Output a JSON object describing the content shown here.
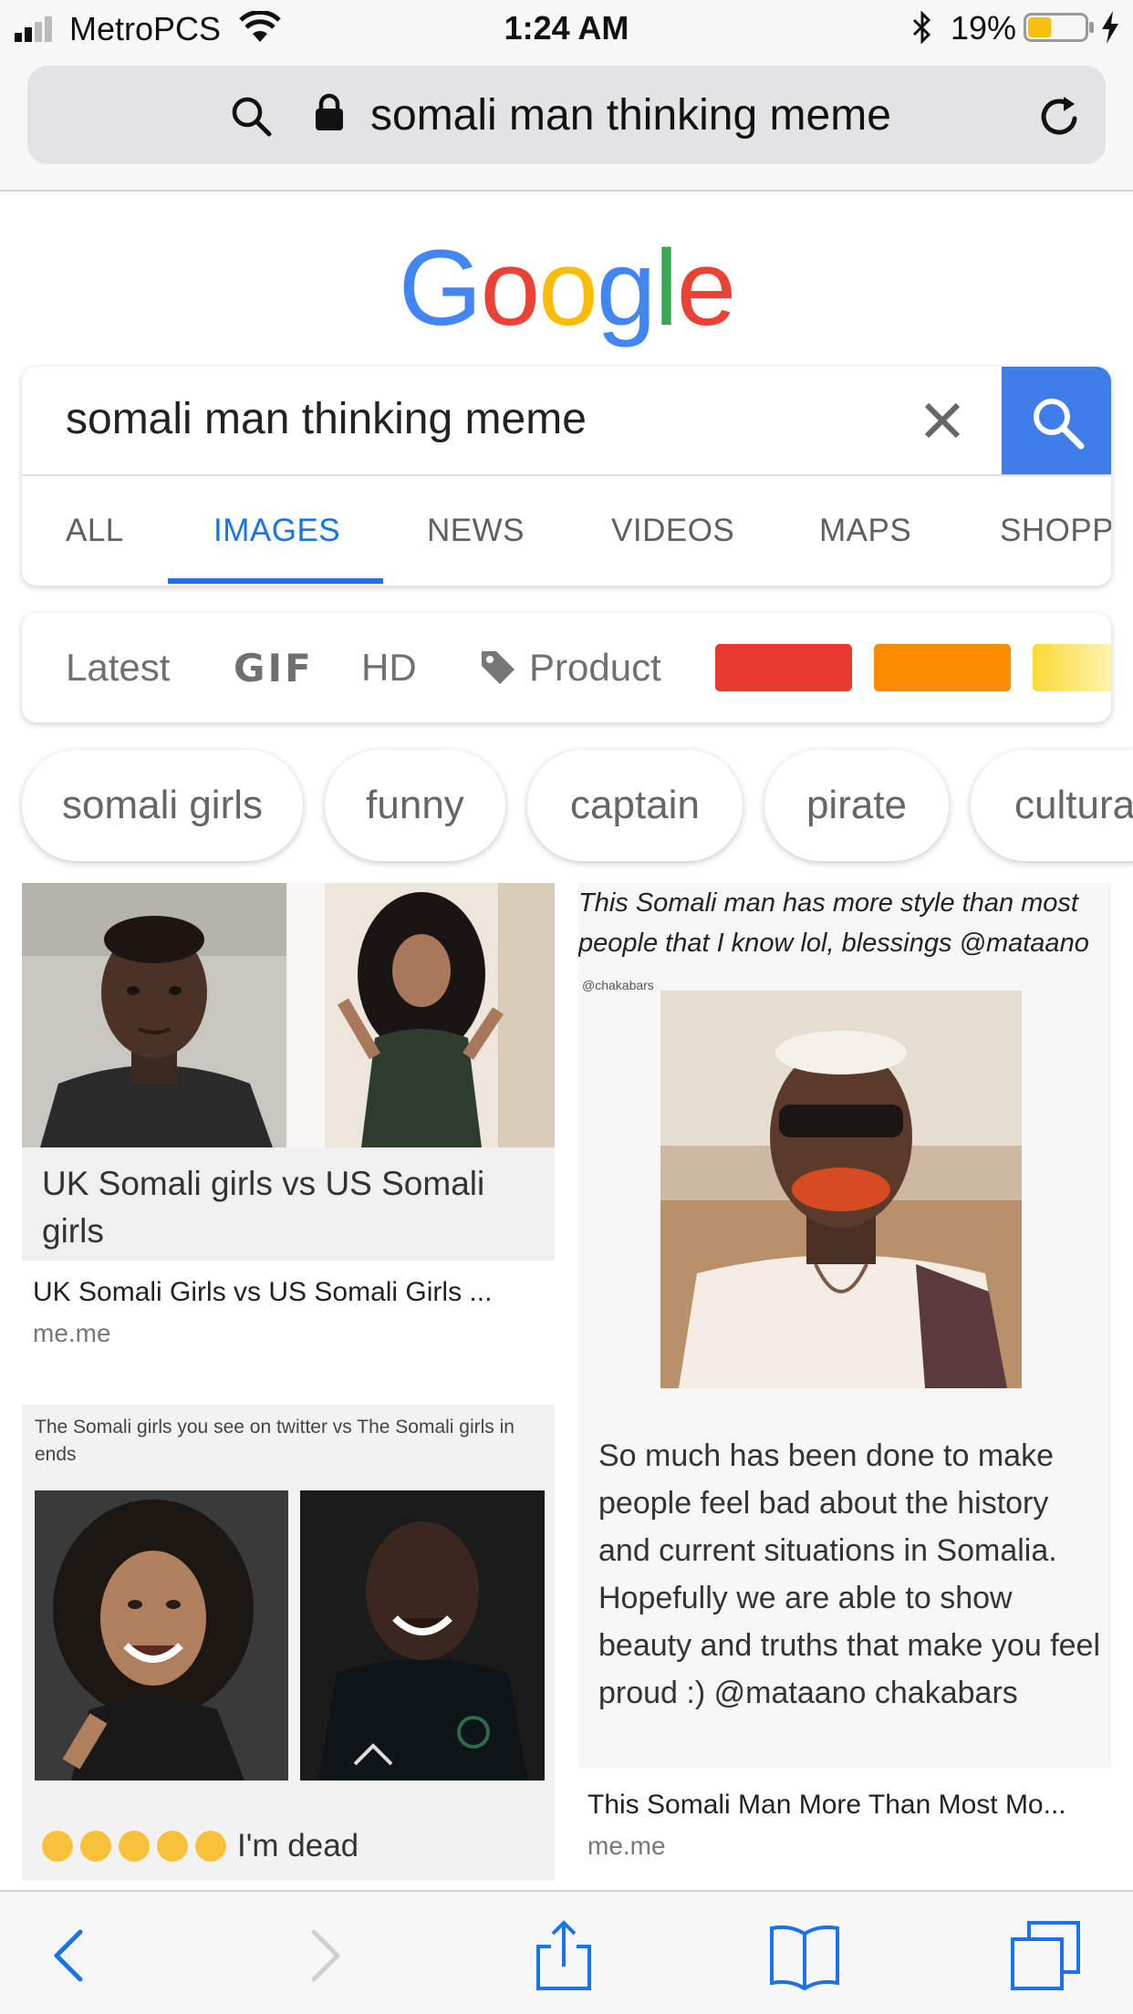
{
  "status_bar": {
    "carrier": "MetroPCS",
    "time": "1:24 AM",
    "battery_percent": "19%",
    "battery_level": 0.19
  },
  "browser": {
    "url_text": "somali man thinking meme"
  },
  "google": {
    "logo_letters": [
      "G",
      "o",
      "o",
      "g",
      "l",
      "e"
    ],
    "logo_colors": [
      "#4285F4",
      "#EA4335",
      "#FBBC05",
      "#4285F4",
      "#34A853",
      "#EA4335"
    ]
  },
  "search": {
    "query": "somali man thinking meme"
  },
  "tabs": [
    "ALL",
    "IMAGES",
    "NEWS",
    "VIDEOS",
    "MAPS",
    "SHOPPING"
  ],
  "active_tab": "IMAGES",
  "filters": {
    "latest": "Latest",
    "gif": "GIF",
    "hd": "HD",
    "product": "Product",
    "color_swatches": [
      "#e8392f",
      "#fb8c00",
      "#fdd835"
    ]
  },
  "chips": [
    "somali girls",
    "funny",
    "captain",
    "pirate",
    "cultural"
  ],
  "results": {
    "r1": {
      "caption": "UK Somali girls vs US Somali girls",
      "title": "UK Somali Girls vs US Somali Girls ...",
      "source": "me.me"
    },
    "r2": {
      "header": "The Somali girls you see on twitter vs The Somali girls in ends",
      "caption": "I'm dead"
    },
    "r3": {
      "header": "This Somali man has more style than most people that I know lol, blessings @mataano",
      "handle": "@chakabars",
      "body": "So much has been done to make people feel bad about the history and current situations in Somalia. Hopefully we are able to show beauty and truths that make you feel proud :) @mataano chakabars",
      "title": "This Somali Man More Than Most Mo...",
      "source": "me.me"
    }
  },
  "toolbar": {
    "icons": [
      "back-icon",
      "forward-icon",
      "share-icon",
      "bookmarks-icon",
      "tabs-icon"
    ]
  }
}
